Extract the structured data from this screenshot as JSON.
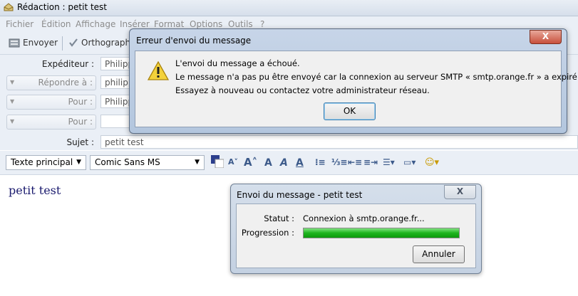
{
  "window": {
    "title": "Rédaction : petit test"
  },
  "menu": [
    "Fichier",
    "Édition",
    "Affichage",
    "Insérer",
    "Format",
    "Options",
    "Outils",
    "?"
  ],
  "toolbar": {
    "send_label": "Envoyer",
    "spell_label": "Orthographe"
  },
  "headers": {
    "from_label": "Expéditeur :",
    "from_value": "Philippe",
    "reply_label": "Répondre à :",
    "reply_value": "philippe",
    "to1_label": "Pour :",
    "to1_value": "Philippe",
    "to2_label": "Pour :",
    "subject_label": "Sujet :",
    "subject_value": "petit test"
  },
  "format_bar": {
    "paragraph_style": "Texte principal",
    "font": "Comic Sans MS"
  },
  "editor": {
    "body": "petit test"
  },
  "error_dialog": {
    "title": "Erreur d'envoi du message",
    "line1": "L'envoi du message a échoué.",
    "line2": "Le message n'a pas pu être envoyé car la connexion au serveur SMTP « smtp.orange.fr » a expiré.",
    "line3": "Essayez à nouveau ou contactez votre administrateur réseau.",
    "ok_label": "OK",
    "close_label": "X"
  },
  "send_dialog": {
    "title": "Envoi du message - petit test",
    "status_label": "Statut :",
    "status_value": "Connexion à smtp.orange.fr...",
    "progress_label": "Progression :",
    "progress": 1.0,
    "cancel_label": "Annuler",
    "close_label": "X"
  }
}
